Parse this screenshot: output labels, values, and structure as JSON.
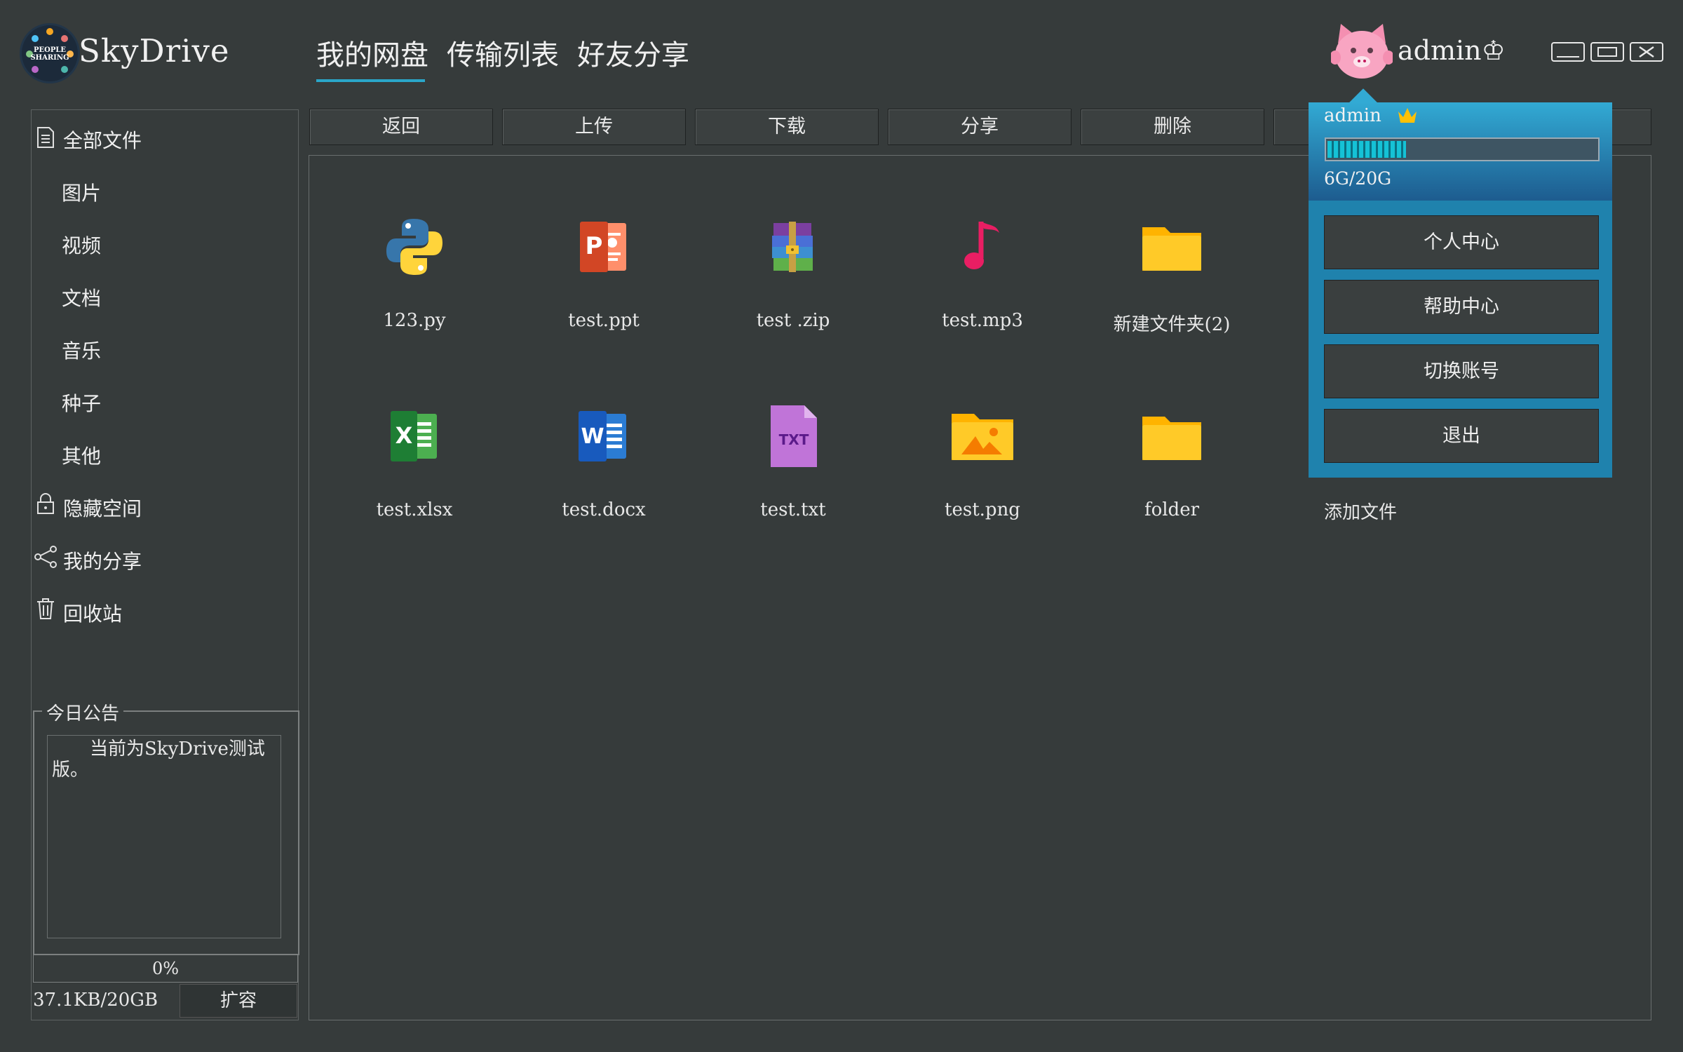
{
  "app": {
    "title": "SkyDrive",
    "logo_text": [
      "PEOPLE",
      "SHARING"
    ]
  },
  "nav": {
    "tabs": [
      "我的网盘",
      "传输列表",
      "好友分享"
    ],
    "active": 0
  },
  "user": {
    "name": "admin",
    "badge": "♔"
  },
  "sidebar": {
    "items": [
      {
        "label": "全部文件",
        "icon": "document-icon"
      },
      {
        "label": "图片"
      },
      {
        "label": "视频"
      },
      {
        "label": "文档"
      },
      {
        "label": "音乐"
      },
      {
        "label": "种子"
      },
      {
        "label": "其他"
      },
      {
        "label": "隐藏空间",
        "icon": "lock-icon"
      },
      {
        "label": "我的分享",
        "icon": "share-icon"
      },
      {
        "label": "回收站",
        "icon": "trash-icon"
      }
    ],
    "notice_title": "今日公告",
    "notice_text": "当前为SkyDrive测试版。",
    "quota_percent": "0%",
    "quota_fraction": 0,
    "used": "37.1KB/20GB",
    "expand_label": "扩容"
  },
  "toolbar": {
    "buttons": [
      "返回",
      "上传",
      "下载",
      "分享",
      "删除"
    ]
  },
  "files": [
    {
      "name": "123.py",
      "icon": "python-icon"
    },
    {
      "name": "test.ppt",
      "icon": "powerpoint-icon"
    },
    {
      "name": "test .zip",
      "icon": "archive-icon"
    },
    {
      "name": "test.mp3",
      "icon": "music-note-icon"
    },
    {
      "name": "新建文件夹(2)",
      "icon": "folder-icon"
    },
    {
      "name": "test.xlsx",
      "icon": "excel-icon"
    },
    {
      "name": "test.docx",
      "icon": "word-icon"
    },
    {
      "name": "test.txt",
      "icon": "txt-file-icon",
      "badge": "TXT"
    },
    {
      "name": "test.png",
      "icon": "image-folder-icon"
    },
    {
      "name": "folder",
      "icon": "folder-icon"
    },
    {
      "name": "添加文件",
      "icon": "add-file"
    }
  ],
  "popup": {
    "name": "admin",
    "storage": "6G/20G",
    "storage_fraction": 0.3,
    "buttons": [
      "个人中心",
      "帮助中心",
      "切换账号",
      "退出"
    ]
  },
  "colors": {
    "accent": "#2aa6c9",
    "background": "#363b3b",
    "folder": "#ffca28"
  }
}
